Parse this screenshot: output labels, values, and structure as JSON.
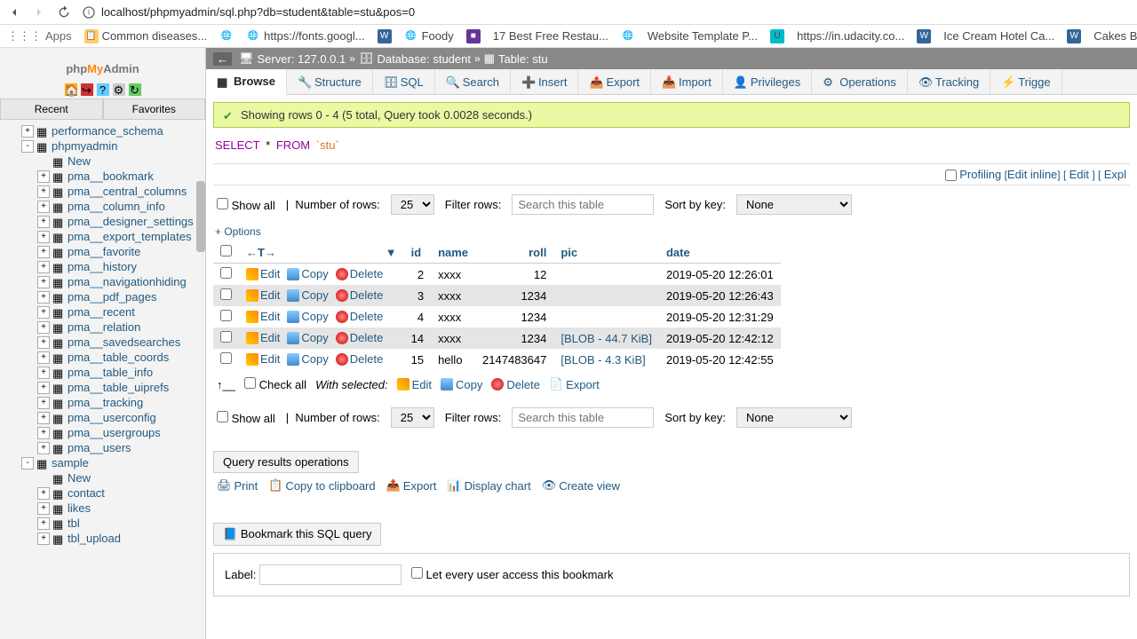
{
  "url": "localhost/phpmyadmin/sql.php?db=student&table=stu&pos=0",
  "bookmarks": [
    "Apps",
    "Common diseases...",
    "",
    "https://fonts.googl...",
    "",
    "Foody",
    "",
    "17 Best Free Restau...",
    "",
    "Website Template P...",
    "",
    "https://in.udacity.co...",
    "",
    "Ice Cream Hotel Ca...",
    "",
    "Cakes Bakery Resta..."
  ],
  "breadcrumb": {
    "server": "Server: 127.0.0.1",
    "db": "Database: student",
    "table": "Table: stu"
  },
  "tabs": [
    "Browse",
    "Structure",
    "SQL",
    "Search",
    "Insert",
    "Export",
    "Import",
    "Privileges",
    "Operations",
    "Tracking",
    "Trigge"
  ],
  "success": "Showing rows 0 - 4 (5 total, Query took 0.0028 seconds.)",
  "sql_kw1": "SELECT",
  "sql_star": "*",
  "sql_kw2": "FROM",
  "sql_tbl": "`stu`",
  "profiling": "Profiling",
  "editinline": "Edit inline",
  "edit": "Edit",
  "explain": "Expl",
  "showall": "Show all",
  "numrows": "Number of rows:",
  "rows_sel": "25",
  "filter": "Filter rows:",
  "filter_ph": "Search this table",
  "sortby": "Sort by key:",
  "sort_sel": "None",
  "options": "+ Options",
  "cols": [
    "id",
    "name",
    "roll",
    "pic",
    "date"
  ],
  "rows": [
    {
      "id": "2",
      "name": "xxxx",
      "roll": "12",
      "pic": "",
      "date": "2019-05-20 12:26:01"
    },
    {
      "id": "3",
      "name": "xxxx",
      "roll": "1234",
      "pic": "",
      "date": "2019-05-20 12:26:43"
    },
    {
      "id": "4",
      "name": "xxxx",
      "roll": "1234",
      "pic": "",
      "date": "2019-05-20 12:31:29"
    },
    {
      "id": "14",
      "name": "xxxx",
      "roll": "1234",
      "pic": "[BLOB - 44.7 KiB]",
      "date": "2019-05-20 12:42:12"
    },
    {
      "id": "15",
      "name": "hello",
      "roll": "2147483647",
      "pic": "[BLOB - 4.3 KiB]",
      "date": "2019-05-20 12:42:55"
    }
  ],
  "act": {
    "edit": "Edit",
    "copy": "Copy",
    "del": "Delete"
  },
  "checkall": "Check all",
  "withsel": "With selected:",
  "b_edit": "Edit",
  "b_copy": "Copy",
  "b_del": "Delete",
  "b_export": "Export",
  "qro": "Query results operations",
  "ops": {
    "print": "Print",
    "clip": "Copy to clipboard",
    "export": "Export",
    "chart": "Display chart",
    "view": "Create view"
  },
  "bookmark": "Bookmark this SQL query",
  "label": "Label:",
  "everyuser": "Let every user access this bookmark",
  "sidebar_tabs": [
    "Recent",
    "Favorites"
  ],
  "tree": [
    {
      "lvl": 1,
      "exp": "+",
      "txt": "performance_schema"
    },
    {
      "lvl": 1,
      "exp": "-",
      "txt": "phpmyadmin"
    },
    {
      "lvl": 2,
      "exp": "",
      "txt": "New"
    },
    {
      "lvl": 2,
      "exp": "+",
      "txt": "pma__bookmark"
    },
    {
      "lvl": 2,
      "exp": "+",
      "txt": "pma__central_columns"
    },
    {
      "lvl": 2,
      "exp": "+",
      "txt": "pma__column_info"
    },
    {
      "lvl": 2,
      "exp": "+",
      "txt": "pma__designer_settings"
    },
    {
      "lvl": 2,
      "exp": "+",
      "txt": "pma__export_templates"
    },
    {
      "lvl": 2,
      "exp": "+",
      "txt": "pma__favorite"
    },
    {
      "lvl": 2,
      "exp": "+",
      "txt": "pma__history"
    },
    {
      "lvl": 2,
      "exp": "+",
      "txt": "pma__navigationhiding"
    },
    {
      "lvl": 2,
      "exp": "+",
      "txt": "pma__pdf_pages"
    },
    {
      "lvl": 2,
      "exp": "+",
      "txt": "pma__recent"
    },
    {
      "lvl": 2,
      "exp": "+",
      "txt": "pma__relation"
    },
    {
      "lvl": 2,
      "exp": "+",
      "txt": "pma__savedsearches"
    },
    {
      "lvl": 2,
      "exp": "+",
      "txt": "pma__table_coords"
    },
    {
      "lvl": 2,
      "exp": "+",
      "txt": "pma__table_info"
    },
    {
      "lvl": 2,
      "exp": "+",
      "txt": "pma__table_uiprefs"
    },
    {
      "lvl": 2,
      "exp": "+",
      "txt": "pma__tracking"
    },
    {
      "lvl": 2,
      "exp": "+",
      "txt": "pma__userconfig"
    },
    {
      "lvl": 2,
      "exp": "+",
      "txt": "pma__usergroups"
    },
    {
      "lvl": 2,
      "exp": "+",
      "txt": "pma__users"
    },
    {
      "lvl": 1,
      "exp": "-",
      "txt": "sample"
    },
    {
      "lvl": 2,
      "exp": "",
      "txt": "New"
    },
    {
      "lvl": 2,
      "exp": "+",
      "txt": "contact"
    },
    {
      "lvl": 2,
      "exp": "+",
      "txt": "likes"
    },
    {
      "lvl": 2,
      "exp": "+",
      "txt": "tbl"
    },
    {
      "lvl": 2,
      "exp": "+",
      "txt": "tbl_upload"
    }
  ]
}
